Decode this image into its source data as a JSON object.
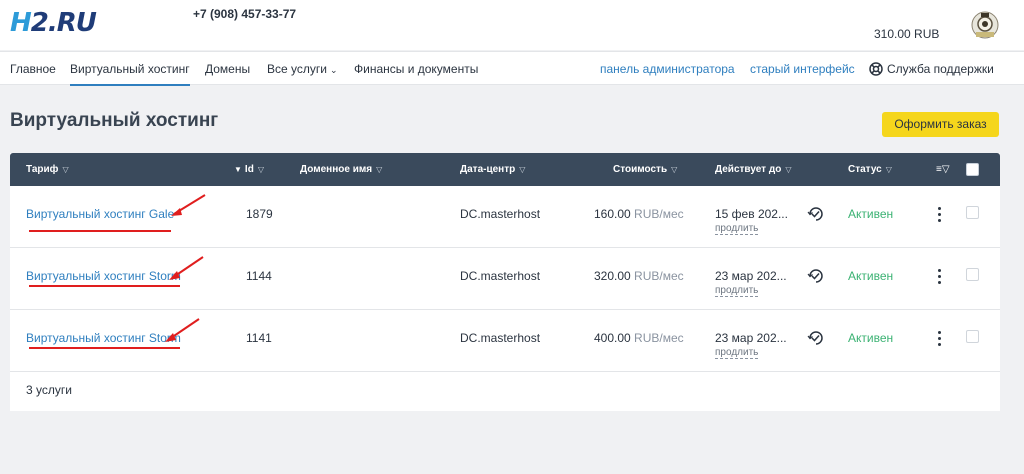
{
  "header": {
    "logo": "H2.RU",
    "phone": "+7 (908) 457-33-77",
    "balance": "310.00 RUB",
    "avatar_icon": "user-avatar-icon"
  },
  "nav": {
    "items": [
      {
        "label": "Главное"
      },
      {
        "label": "Виртуальный хостинг"
      },
      {
        "label": "Домены"
      },
      {
        "label": "Все услуги"
      },
      {
        "label": "Финансы и документы"
      }
    ],
    "right": {
      "admin_panel": "панель администратора",
      "old_interface": "старый интерфейс",
      "support": "Служба поддержки"
    }
  },
  "page": {
    "title": "Виртуальный хостинг",
    "order_button": "Оформить заказ"
  },
  "table": {
    "columns": {
      "tariff": "Тариф",
      "id": "Id",
      "domain": "Доменное имя",
      "datacenter": "Дата-центр",
      "cost": "Стоимость",
      "valid_until": "Действует до",
      "status": "Статус"
    },
    "rows": [
      {
        "tariff": "Виртуальный хостинг Gale",
        "id": "1879",
        "domain": "",
        "datacenter": "DC.masterhost",
        "cost": "160.00",
        "cost_unit": "RUB/мес",
        "valid_until": "15 фев 202...",
        "prolong": "продлить",
        "status": "Активен"
      },
      {
        "tariff": "Виртуальный хостинг Storm",
        "id": "1144",
        "domain": "",
        "datacenter": "DC.masterhost",
        "cost": "320.00",
        "cost_unit": "RUB/мес",
        "valid_until": "23 мар 202...",
        "prolong": "продлить",
        "status": "Активен"
      },
      {
        "tariff": "Виртуальный хостинг Storm",
        "id": "1141",
        "domain": "",
        "datacenter": "DC.masterhost",
        "cost": "400.00",
        "cost_unit": "RUB/мес",
        "valid_until": "23 мар 202...",
        "prolong": "продлить",
        "status": "Активен"
      }
    ],
    "footer": "3 услуги"
  },
  "colors": {
    "accent": "#2f7fbf",
    "header_dark": "#3a4a5c",
    "button_yellow": "#f5d61c",
    "status_green": "#3bb273",
    "annotation_red": "#e01e1e"
  }
}
